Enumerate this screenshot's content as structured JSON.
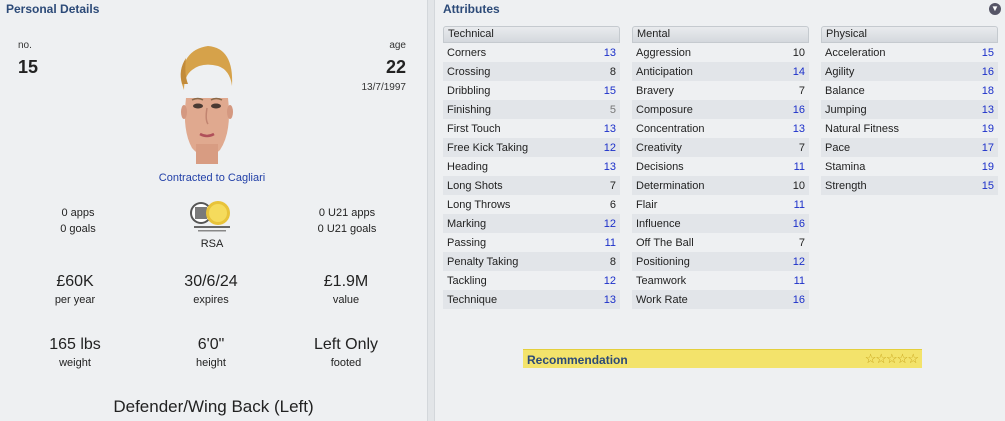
{
  "personal": {
    "title": "Personal Details",
    "no_label": "no.",
    "no_value": "15",
    "age_label": "age",
    "age_value": "22",
    "dob": "13/7/1997",
    "contract": "Contracted to Cagliari",
    "apps": "0 apps",
    "goals": "0 goals",
    "u21_apps": "0 U21 apps",
    "u21_goals": "0 U21 goals",
    "nation": "RSA",
    "wage_value": "£60K",
    "wage_label": "per year",
    "expires_value": "30/6/24",
    "expires_label": "expires",
    "value_value": "£1.9M",
    "value_label": "value",
    "weight_value": "165 lbs",
    "weight_label": "weight",
    "height_value": "6'0\"",
    "height_label": "height",
    "footed_value": "Left Only",
    "footed_label": "footed",
    "position": "Defender/Wing Back (Left)"
  },
  "attributes": {
    "title": "Attributes",
    "technical": {
      "header": "Technical",
      "rows": [
        {
          "name": "Corners",
          "value": "13",
          "level": "hi"
        },
        {
          "name": "Crossing",
          "value": "8",
          "level": "mid"
        },
        {
          "name": "Dribbling",
          "value": "15",
          "level": "hi"
        },
        {
          "name": "Finishing",
          "value": "5",
          "level": "lo"
        },
        {
          "name": "First Touch",
          "value": "13",
          "level": "hi"
        },
        {
          "name": "Free Kick Taking",
          "value": "12",
          "level": "hi"
        },
        {
          "name": "Heading",
          "value": "13",
          "level": "hi"
        },
        {
          "name": "Long Shots",
          "value": "7",
          "level": "mid"
        },
        {
          "name": "Long Throws",
          "value": "6",
          "level": "mid"
        },
        {
          "name": "Marking",
          "value": "12",
          "level": "hi"
        },
        {
          "name": "Passing",
          "value": "11",
          "level": "hi"
        },
        {
          "name": "Penalty Taking",
          "value": "8",
          "level": "mid"
        },
        {
          "name": "Tackling",
          "value": "12",
          "level": "hi"
        },
        {
          "name": "Technique",
          "value": "13",
          "level": "hi"
        }
      ]
    },
    "mental": {
      "header": "Mental",
      "rows": [
        {
          "name": "Aggression",
          "value": "10",
          "level": "mid"
        },
        {
          "name": "Anticipation",
          "value": "14",
          "level": "hi"
        },
        {
          "name": "Bravery",
          "value": "7",
          "level": "mid"
        },
        {
          "name": "Composure",
          "value": "16",
          "level": "hi"
        },
        {
          "name": "Concentration",
          "value": "13",
          "level": "hi"
        },
        {
          "name": "Creativity",
          "value": "7",
          "level": "mid"
        },
        {
          "name": "Decisions",
          "value": "11",
          "level": "hi"
        },
        {
          "name": "Determination",
          "value": "10",
          "level": "mid"
        },
        {
          "name": "Flair",
          "value": "11",
          "level": "hi"
        },
        {
          "name": "Influence",
          "value": "16",
          "level": "hi"
        },
        {
          "name": "Off The Ball",
          "value": "7",
          "level": "mid"
        },
        {
          "name": "Positioning",
          "value": "12",
          "level": "hi"
        },
        {
          "name": "Teamwork",
          "value": "11",
          "level": "hi"
        },
        {
          "name": "Work Rate",
          "value": "16",
          "level": "hi"
        }
      ]
    },
    "physical": {
      "header": "Physical",
      "rows": [
        {
          "name": "Acceleration",
          "value": "15",
          "level": "hi"
        },
        {
          "name": "Agility",
          "value": "16",
          "level": "hi"
        },
        {
          "name": "Balance",
          "value": "18",
          "level": "hi"
        },
        {
          "name": "Jumping",
          "value": "13",
          "level": "hi"
        },
        {
          "name": "Natural Fitness",
          "value": "19",
          "level": "hi"
        },
        {
          "name": "Pace",
          "value": "17",
          "level": "hi"
        },
        {
          "name": "Stamina",
          "value": "19",
          "level": "hi"
        },
        {
          "name": "Strength",
          "value": "15",
          "level": "hi"
        }
      ]
    }
  },
  "recommendation": {
    "label": "Recommendation",
    "stars": "☆☆☆☆☆"
  },
  "icons": {
    "collapse": "chevron-down-icon",
    "collapse_glyph": "▼"
  },
  "colors": {
    "title": "#2c4a78",
    "link": "#2240a8",
    "high_value": "#1b2fc9",
    "recommendation_bg": "#f3e36b"
  }
}
